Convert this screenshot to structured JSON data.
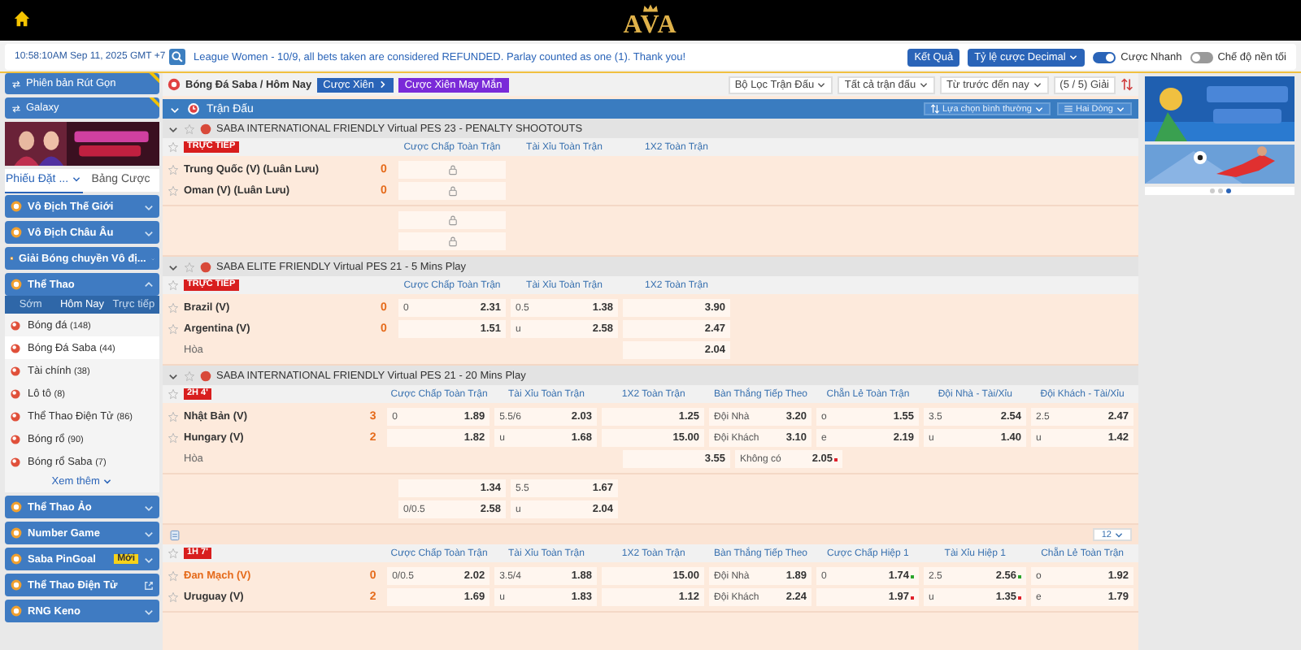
{
  "topbar": {
    "logo": "AVA"
  },
  "infobar": {
    "time": "10:58:10AM Sep 11, 2025 GMT +7",
    "notice": "League Women - 10/9, all bets taken are considered REFUNDED. Parlay counted as one (1). Thank you!",
    "results": "Kết Quả",
    "odds_format": "Tỷ lệ cược Decimal",
    "toggles": [
      {
        "label": "Cược Nhanh",
        "on": true
      },
      {
        "label": "Chế độ nền tối",
        "on": false
      }
    ]
  },
  "sidebar": {
    "buttons": [
      {
        "label": "Phiên bản Rút Gọn",
        "new": true
      },
      {
        "label": "Galaxy",
        "new": true
      }
    ],
    "bet_tabs": [
      {
        "label": "Phiếu Đặt ...",
        "selected": true
      },
      {
        "label": "Bảng Cược",
        "selected": false
      }
    ],
    "menu": [
      {
        "label": "Vô Địch Thế Giới",
        "expanded": false
      },
      {
        "label": "Vô Địch Châu Âu",
        "expanded": false
      },
      {
        "label": "Giải Bóng chuyền Vô đị...",
        "expanded": false
      },
      {
        "label": "Thể Thao",
        "expanded": true,
        "tabs": [
          {
            "label": "Sớm",
            "selected": false
          },
          {
            "label": "Hôm Nay",
            "selected": true
          },
          {
            "label": "Trực tiếp",
            "selected": false
          }
        ],
        "items": [
          {
            "label": "Bóng đá",
            "count": "(148)",
            "selected": false
          },
          {
            "label": "Bóng Đá Saba",
            "count": "(44)",
            "selected": true
          },
          {
            "label": "Tài chính",
            "count": "(38)",
            "selected": false
          },
          {
            "label": "Lô tô",
            "count": "(8)",
            "selected": false
          },
          {
            "label": "Thể Thao Điện Tử",
            "count": "(86)",
            "selected": false
          },
          {
            "label": "Bóng rổ",
            "count": "(90)",
            "selected": false
          },
          {
            "label": "Bóng rổ Saba",
            "count": "(7)",
            "selected": false
          }
        ],
        "more": "Xem thêm"
      },
      {
        "label": "Thể Thao Ảo",
        "expanded": false
      },
      {
        "label": "Number Game",
        "expanded": false
      },
      {
        "label": "Saba PinGoal",
        "expanded": false,
        "badge": "Mới"
      },
      {
        "label": "Thể Thao Điện Tử",
        "expanded": false,
        "external": true
      },
      {
        "label": "RNG Keno",
        "expanded": false
      }
    ]
  },
  "toolbar": {
    "breadcrumb": "Bóng Đá Saba / Hôm Nay",
    "parlay": "Cược Xiên",
    "lucky_parlay": "Cược Xiên May Mắn",
    "filters": [
      "Bộ Lọc Trận Đấu",
      "Tất cả trận đấu",
      "Từ trước đến nay"
    ],
    "league_count": "(5 / 5) Giải"
  },
  "section": {
    "title": "Trận Đấu",
    "view": "Lựa chọn bình thường",
    "rows_mode": "Hai Dòng"
  },
  "leagues": [
    {
      "title": "SABA INTERNATIONAL FRIENDLY Virtual PES 23 - PENALTY SHOOTOUTS",
      "matches": [
        {
          "status": "TRỰC TIẾP",
          "headers": [
            "Cược Chấp Toàn Trận",
            "Tài Xỉu Toàn Trận",
            "1X2 Toàn Trận"
          ],
          "blocks": [
            {
              "rows": [
                {
                  "kind": "team",
                  "name": "Trung Quốc (V) (Luân Lưu)",
                  "score": "0",
                  "cells": [
                    {
                      "kind": "locked"
                    }
                  ]
                },
                {
                  "kind": "team",
                  "name": "Oman (V) (Luân Lưu)",
                  "score": "0",
                  "cells": [
                    {
                      "kind": "locked"
                    }
                  ]
                }
              ]
            },
            {
              "rows": [
                {
                  "kind": "extra",
                  "cells": [
                    {
                      "kind": "locked"
                    }
                  ]
                },
                {
                  "kind": "extra",
                  "cells": [
                    {
                      "kind": "locked"
                    }
                  ]
                }
              ]
            }
          ]
        }
      ]
    },
    {
      "title": "SABA ELITE FRIENDLY Virtual PES 21 - 5 Mins Play",
      "matches": [
        {
          "status": "TRỰC TIẾP",
          "headers": [
            "Cược Chấp Toàn Trận",
            "Tài Xỉu Toàn Trận",
            "1X2 Toàn Trận"
          ],
          "blocks": [
            {
              "rows": [
                {
                  "kind": "team",
                  "name": "Brazil (V)",
                  "score": "0",
                  "cells": [
                    {
                      "kind": "odds",
                      "line": "0",
                      "odds": "2.31"
                    },
                    {
                      "kind": "odds",
                      "line": "0.5",
                      "odds": "1.38"
                    },
                    {
                      "kind": "odds",
                      "odds": "3.90"
                    }
                  ]
                },
                {
                  "kind": "team",
                  "name": "Argentina (V)",
                  "score": "0",
                  "cells": [
                    {
                      "kind": "odds",
                      "odds": "1.51"
                    },
                    {
                      "kind": "odds",
                      "line": "u",
                      "odds": "2.58"
                    },
                    {
                      "kind": "odds",
                      "odds": "2.47"
                    }
                  ]
                },
                {
                  "kind": "draw",
                  "name": "Hòa",
                  "cells": [
                    null,
                    null,
                    {
                      "kind": "odds",
                      "odds": "2.04"
                    }
                  ]
                }
              ]
            }
          ]
        }
      ]
    },
    {
      "title": "SABA INTERNATIONAL FRIENDLY Virtual PES 21 - 20 Mins Play",
      "matches": [
        {
          "status": "2H 4'",
          "headers": [
            "Cược Chấp Toàn Trận",
            "Tài Xỉu Toàn Trận",
            "1X2 Toàn Trận",
            "Bàn Thắng Tiếp Theo",
            "Chẵn Lẻ Toàn Trận",
            "Đội Nhà - Tài/Xỉu",
            "Đội Khách - Tài/Xỉu"
          ],
          "footer": "12",
          "blocks": [
            {
              "rows": [
                {
                  "kind": "team",
                  "name": "Nhật Bản (V)",
                  "score": "3",
                  "cells": [
                    {
                      "kind": "odds",
                      "line": "0",
                      "odds": "1.89"
                    },
                    {
                      "kind": "odds",
                      "line": "5.5/6",
                      "odds": "2.03"
                    },
                    {
                      "kind": "odds",
                      "odds": "1.25"
                    },
                    {
                      "kind": "odds",
                      "line": "Đội Nhà",
                      "odds": "3.20"
                    },
                    {
                      "kind": "odds",
                      "line": "o",
                      "odds": "1.55"
                    },
                    {
                      "kind": "odds",
                      "line": "3.5",
                      "odds": "2.54"
                    },
                    {
                      "kind": "odds",
                      "line": "2.5",
                      "odds": "2.47"
                    }
                  ]
                },
                {
                  "kind": "team",
                  "name": "Hungary (V)",
                  "score": "2",
                  "cells": [
                    {
                      "kind": "odds",
                      "odds": "1.82"
                    },
                    {
                      "kind": "odds",
                      "line": "u",
                      "odds": "1.68"
                    },
                    {
                      "kind": "odds",
                      "odds": "15.00"
                    },
                    {
                      "kind": "odds",
                      "line": "Đội Khách",
                      "odds": "3.10"
                    },
                    {
                      "kind": "odds",
                      "line": "e",
                      "odds": "2.19"
                    },
                    {
                      "kind": "odds",
                      "line": "u",
                      "odds": "1.40"
                    },
                    {
                      "kind": "odds",
                      "line": "u",
                      "odds": "1.42"
                    }
                  ]
                },
                {
                  "kind": "draw",
                  "name": "Hòa",
                  "cells": [
                    null,
                    null,
                    {
                      "kind": "odds",
                      "odds": "3.55"
                    },
                    {
                      "kind": "odds",
                      "line": "Không có",
                      "odds": "2.05",
                      "color": "#e0202a"
                    }
                  ]
                }
              ]
            },
            {
              "rows": [
                {
                  "kind": "extra",
                  "cells": [
                    {
                      "kind": "odds",
                      "odds": "1.34"
                    },
                    {
                      "kind": "odds",
                      "line": "5.5",
                      "odds": "1.67"
                    }
                  ]
                },
                {
                  "kind": "extra",
                  "cells": [
                    {
                      "kind": "odds",
                      "line": "0/0.5",
                      "odds": "2.58"
                    },
                    {
                      "kind": "odds",
                      "line": "u",
                      "odds": "2.04"
                    }
                  ]
                }
              ]
            }
          ]
        },
        {
          "status": "1H 7'",
          "headers": [
            "Cược Chấp Toàn Trận",
            "Tài Xỉu Toàn Trận",
            "1X2 Toàn Trận",
            "Bàn Thắng Tiếp Theo",
            "Cược Chấp Hiệp 1",
            "Tài Xỉu Hiệp 1",
            "Chẵn Lẻ Toàn Trận"
          ],
          "blocks": [
            {
              "rows": [
                {
                  "kind": "team",
                  "name": "Đan Mạch (V)",
                  "score": "0",
                  "highlight": true,
                  "cells": [
                    {
                      "kind": "odds",
                      "line": "0/0.5",
                      "odds": "2.02"
                    },
                    {
                      "kind": "odds",
                      "line": "3.5/4",
                      "odds": "1.88"
                    },
                    {
                      "kind": "odds",
                      "odds": "15.00"
                    },
                    {
                      "kind": "odds",
                      "line": "Đội Nhà",
                      "odds": "1.89"
                    },
                    {
                      "kind": "odds",
                      "line": "0",
                      "odds": "1.74",
                      "color": "#2aa52a"
                    },
                    {
                      "kind": "odds",
                      "line": "2.5",
                      "odds": "2.56",
                      "color": "#2aa52a"
                    },
                    {
                      "kind": "odds",
                      "line": "o",
                      "odds": "1.92"
                    }
                  ]
                },
                {
                  "kind": "team",
                  "name": "Uruguay (V)",
                  "score": "2",
                  "highlight": false,
                  "cells": [
                    {
                      "kind": "odds",
                      "odds": "1.69"
                    },
                    {
                      "kind": "odds",
                      "line": "u",
                      "odds": "1.83"
                    },
                    {
                      "kind": "odds",
                      "odds": "1.12"
                    },
                    {
                      "kind": "odds",
                      "line": "Đội Khách",
                      "odds": "2.24"
                    },
                    {
                      "kind": "odds",
                      "odds": "1.97",
                      "color": "#e0202a"
                    },
                    {
                      "kind": "odds",
                      "line": "u",
                      "odds": "1.35",
                      "color": "#e0202a"
                    },
                    {
                      "kind": "odds",
                      "line": "e",
                      "odds": "1.79"
                    }
                  ]
                }
              ]
            }
          ]
        }
      ]
    }
  ],
  "banner_dots": [
    {
      "selected": false
    },
    {
      "selected": false
    },
    {
      "selected": true
    }
  ]
}
